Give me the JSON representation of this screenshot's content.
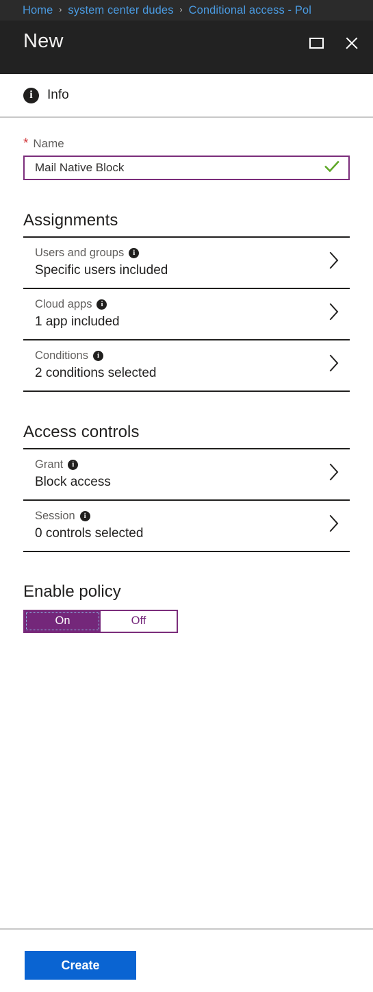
{
  "breadcrumb": {
    "separator": "›",
    "items": [
      {
        "label": "Home"
      },
      {
        "label": "system center dudes"
      },
      {
        "label": "Conditional access - Pol"
      }
    ]
  },
  "titlebar": {
    "title": "New",
    "restore_icon": "restore-window-icon",
    "close_icon": "close-icon"
  },
  "infobar": {
    "icon": "info-icon",
    "icon_glyph": "i",
    "label": "Info"
  },
  "name_field": {
    "required_marker": "*",
    "label": "Name",
    "value": "Mail Native Block",
    "placeholder": "",
    "valid_icon": "checkmark-icon",
    "border_color": "#7b2d7b",
    "check_color": "#5fa828"
  },
  "sections": [
    {
      "title": "Assignments",
      "rows": [
        {
          "label": "Users and groups",
          "info_glyph": "i",
          "value": "Specific users included"
        },
        {
          "label": "Cloud apps",
          "info_glyph": "i",
          "value": "1 app included"
        },
        {
          "label": "Conditions",
          "info_glyph": "i",
          "value": "2 conditions selected"
        }
      ]
    },
    {
      "title": "Access controls",
      "rows": [
        {
          "label": "Grant",
          "info_glyph": "i",
          "value": "Block access"
        },
        {
          "label": "Session",
          "info_glyph": "i",
          "value": "0 controls selected"
        }
      ]
    }
  ],
  "enable_policy": {
    "title": "Enable policy",
    "on_label": "On",
    "off_label": "Off",
    "selected": "On",
    "accent_color": "#74277a"
  },
  "footer": {
    "create_label": "Create",
    "create_color": "#0a64d2"
  }
}
